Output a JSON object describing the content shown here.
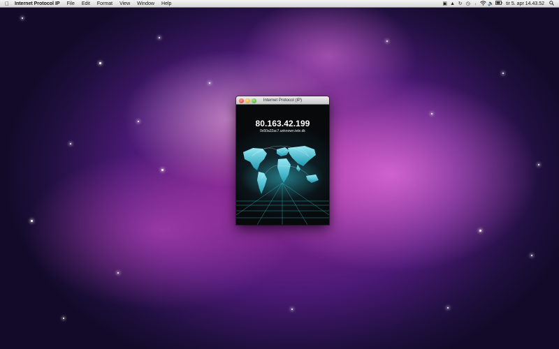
{
  "menubar": {
    "app_name": "Internet Protocol IP",
    "items": [
      "File",
      "Edit",
      "Format",
      "View",
      "Window",
      "Help"
    ],
    "clock": "tir 5. apr 14.43.52"
  },
  "window": {
    "title": "Internet Protocol (IP)",
    "ip_address": "80.163.42.199",
    "hostname": "0x50a32ac7.unknown.tele.dk"
  },
  "colors": {
    "map_accent": "#35d0e0",
    "window_bg": "#101216"
  }
}
